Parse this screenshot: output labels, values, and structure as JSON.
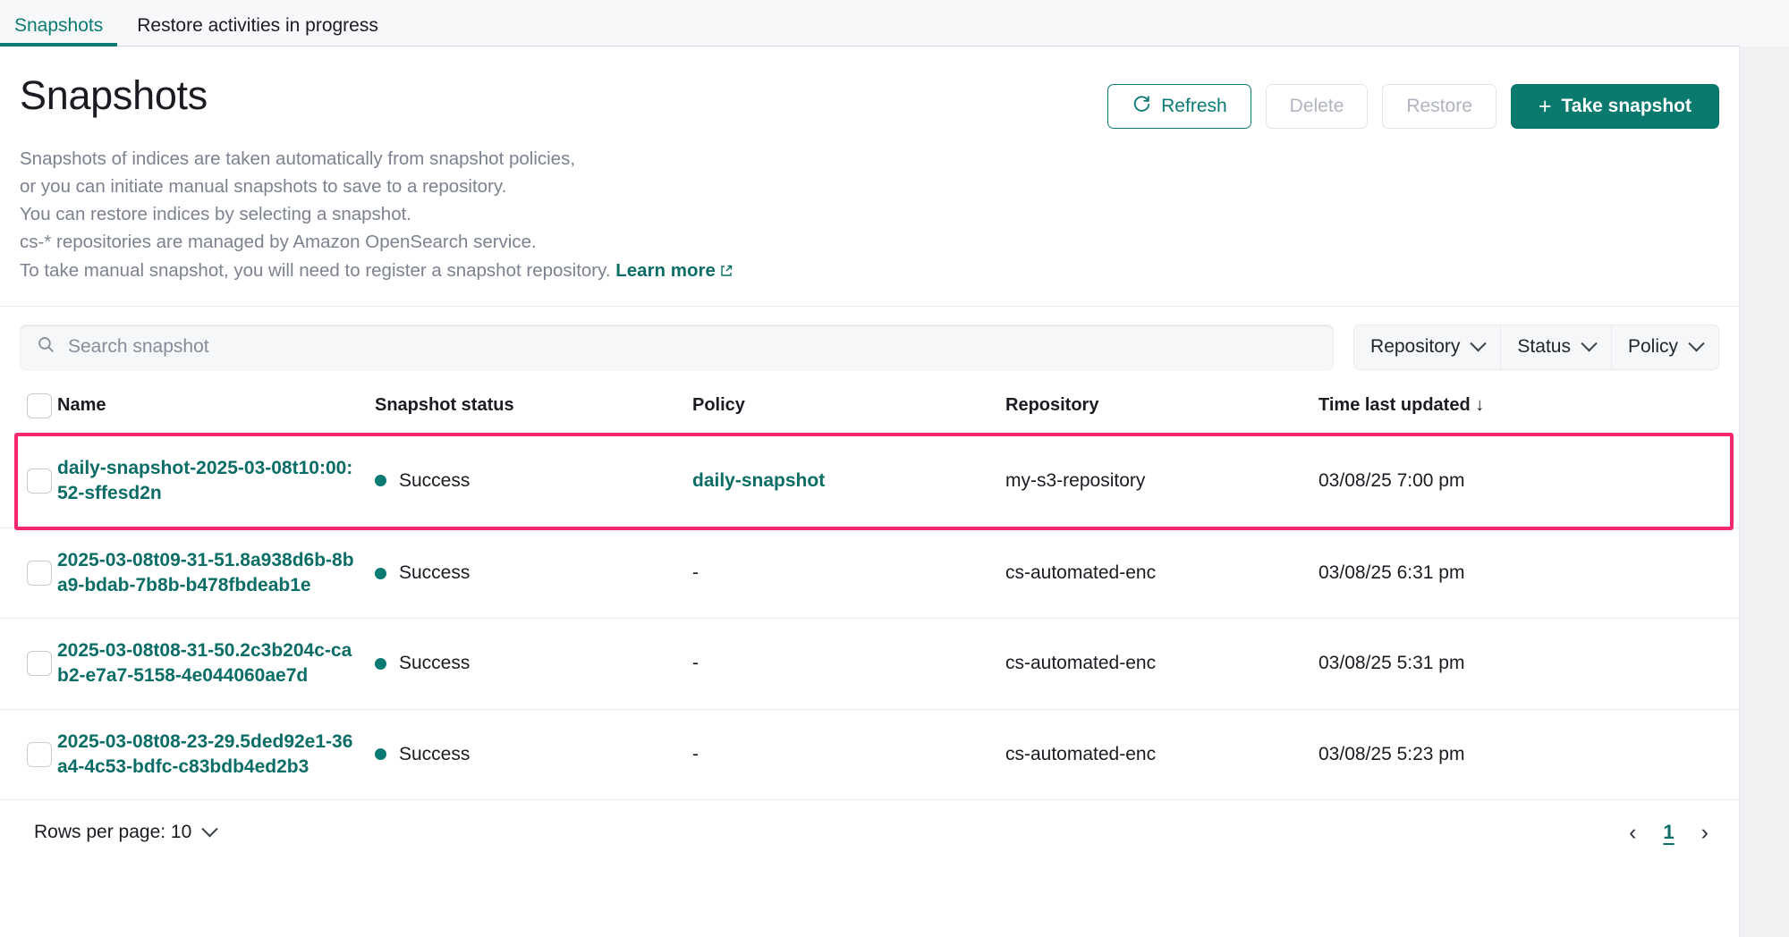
{
  "tabs": [
    {
      "label": "Snapshots",
      "active": true
    },
    {
      "label": "Restore activities in progress",
      "active": false
    }
  ],
  "header": {
    "title": "Snapshots",
    "description_lines": [
      "Snapshots of indices are taken automatically from snapshot policies,",
      "or you can initiate manual snapshots to save to a repository.",
      "You can restore indices by selecting a snapshot.",
      "cs-* repositories are managed by Amazon OpenSearch service."
    ],
    "last_line_prefix": "To take manual snapshot, you will need to register a snapshot repository.",
    "learn_more": "Learn more"
  },
  "toolbar": {
    "refresh_label": "Refresh",
    "delete_label": "Delete",
    "restore_label": "Restore",
    "take_snapshot_label": "Take snapshot",
    "take_snapshot_plus": "+"
  },
  "search": {
    "placeholder": "Search snapshot",
    "value": ""
  },
  "filters": [
    {
      "label": "Repository"
    },
    {
      "label": "Status"
    },
    {
      "label": "Policy"
    }
  ],
  "table": {
    "columns": [
      "Name",
      "Snapshot status",
      "Policy",
      "Repository",
      "Time last updated"
    ],
    "sort_column": "Time last updated",
    "sort_direction_icon": "↓",
    "rows": [
      {
        "name": "daily-snapshot-2025-03-08t10:00:52-sffesd2n",
        "status": "Success",
        "policy": "daily-snapshot",
        "policy_is_link": true,
        "repository": "my-s3-repository",
        "time": "03/08/25 7:00 pm",
        "highlighted": true
      },
      {
        "name": "2025-03-08t09-31-51.8a938d6b-8ba9-bdab-7b8b-b478fbdeab1e",
        "status": "Success",
        "policy": "-",
        "policy_is_link": false,
        "repository": "cs-automated-enc",
        "time": "03/08/25 6:31 pm",
        "highlighted": false
      },
      {
        "name": "2025-03-08t08-31-50.2c3b204c-cab2-e7a7-5158-4e044060ae7d",
        "status": "Success",
        "policy": "-",
        "policy_is_link": false,
        "repository": "cs-automated-enc",
        "time": "03/08/25 5:31 pm",
        "highlighted": false
      },
      {
        "name": "2025-03-08t08-23-29.5ded92e1-36a4-4c53-bdfc-c83bdb4ed2b3",
        "status": "Success",
        "policy": "-",
        "policy_is_link": false,
        "repository": "cs-automated-enc",
        "time": "03/08/25 5:23 pm",
        "highlighted": false
      }
    ]
  },
  "footer": {
    "rows_per_page_label": "Rows per page: 10",
    "prev_icon": "‹",
    "page_number": "1",
    "next_icon": "›"
  },
  "colors": {
    "accent": "#0b7a72",
    "link": "#0b6d66",
    "primary_button": "#0a7a6e",
    "status_success": "#0b7a72",
    "highlight_outline": "#f5296b"
  }
}
